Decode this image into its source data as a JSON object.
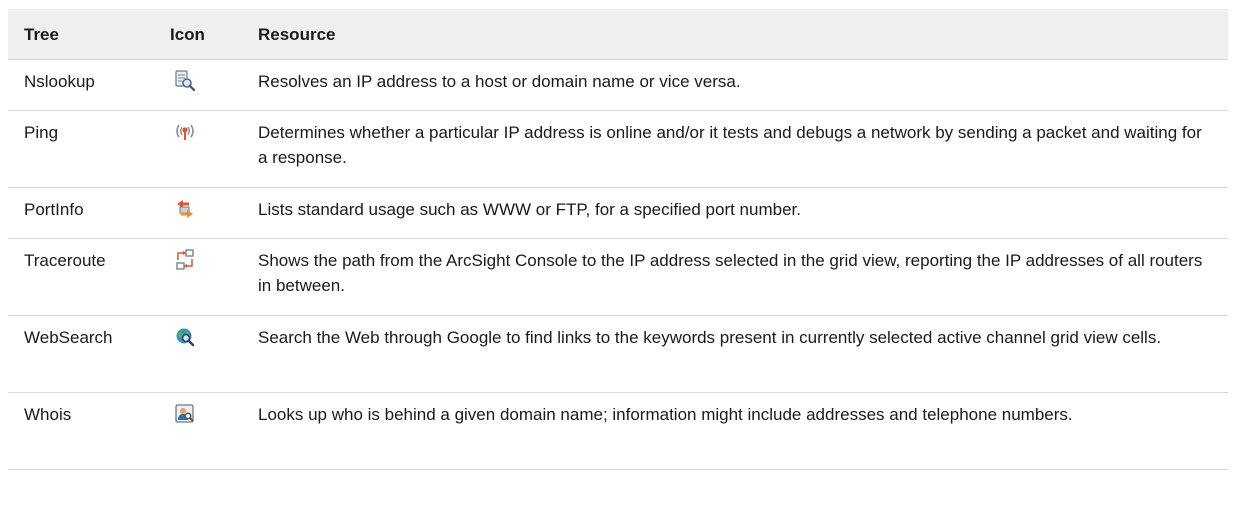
{
  "headers": {
    "tree": "Tree",
    "icon": "Icon",
    "resource": "Resource"
  },
  "rows": [
    {
      "tree": "Nslookup",
      "icon": "nslookup-icon",
      "resource": "Resolves an IP address to a host or domain name or vice versa."
    },
    {
      "tree": "Ping",
      "icon": "ping-icon",
      "resource": "Determines whether a particular IP address is online and/or it tests and debugs a network by sending a packet and waiting for a response."
    },
    {
      "tree": "PortInfo",
      "icon": "portinfo-icon",
      "resource": "Lists standard usage such as WWW or FTP, for a specified port number."
    },
    {
      "tree": "Traceroute",
      "icon": "traceroute-icon",
      "resource": "Shows the path from the ArcSight Console to the IP address selected in the grid view, reporting the IP addresses of all routers in between."
    },
    {
      "tree": "WebSearch",
      "icon": "websearch-icon",
      "resource": "Search the Web through Google to find links to the keywords present in currently selected active channel grid view cells."
    },
    {
      "tree": "Whois",
      "icon": "whois-icon",
      "resource": "Looks up who is behind a given domain name; information might include addresses and telephone numbers."
    }
  ]
}
